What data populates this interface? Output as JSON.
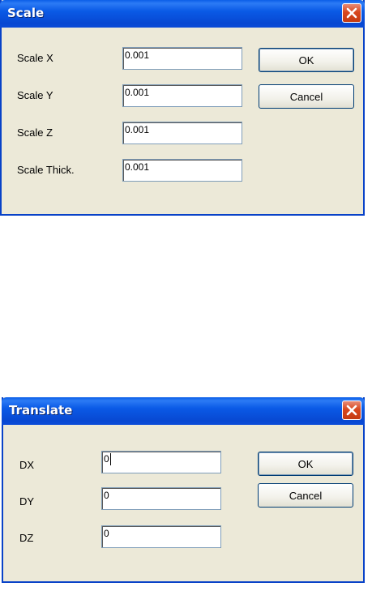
{
  "scale_dialog": {
    "title": "Scale",
    "fields": [
      {
        "label": "Scale X",
        "value": "0.001"
      },
      {
        "label": "Scale Y",
        "value": "0.001"
      },
      {
        "label": "Scale Z",
        "value": "0.001"
      },
      {
        "label": "Scale Thick.",
        "value": "0.001"
      }
    ],
    "ok_label": "OK",
    "cancel_label": "Cancel"
  },
  "translate_dialog": {
    "title": "Translate",
    "fields": [
      {
        "label": "DX",
        "value": "0"
      },
      {
        "label": "DY",
        "value": "0"
      },
      {
        "label": "DZ",
        "value": "0"
      }
    ],
    "ok_label": "OK",
    "cancel_label": "Cancel"
  },
  "icons": {
    "close": "close-icon"
  },
  "colors": {
    "titlebar": "#0a5ae6",
    "close_button": "#d8481f",
    "dialog_face": "#ece9d8"
  }
}
